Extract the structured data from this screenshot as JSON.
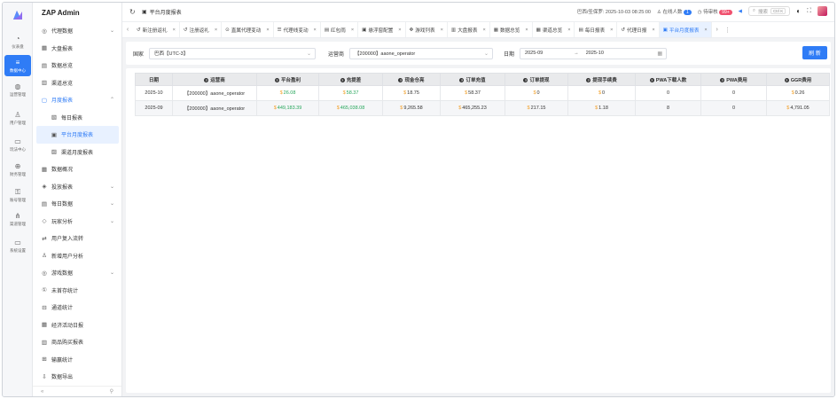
{
  "app": {
    "name": "ZAP Admin"
  },
  "rail": [
    {
      "label": "仪表盘",
      "icon": "dashboard-icon"
    },
    {
      "label": "数据中心",
      "icon": "database-icon",
      "active": true
    },
    {
      "label": "运营管理",
      "icon": "operations-icon"
    },
    {
      "label": "用户管理",
      "icon": "user-icon"
    },
    {
      "label": "玩法中心",
      "icon": "game-icon"
    },
    {
      "label": "财务管理",
      "icon": "globe-icon"
    },
    {
      "label": "账号管理",
      "icon": "key-icon"
    },
    {
      "label": "渠道管理",
      "icon": "channel-icon"
    },
    {
      "label": "系统设置",
      "icon": "monitor-icon"
    }
  ],
  "menu": [
    {
      "label": "代理数据",
      "icon": "◎",
      "chevron": "⌄"
    },
    {
      "label": "大盘报表",
      "icon": "▦"
    },
    {
      "label": "数据总览",
      "icon": "▤"
    },
    {
      "label": "渠道总览",
      "icon": "▥"
    },
    {
      "label": "月度报表",
      "icon": "▢",
      "chevron": "⌃",
      "open": true
    },
    {
      "label": "每日报表",
      "icon": "▧",
      "sub": true
    },
    {
      "label": "平台月度报表",
      "icon": "▣",
      "sub": true,
      "active": true
    },
    {
      "label": "渠道月度报表",
      "icon": "▨",
      "sub": true
    },
    {
      "label": "数据概况",
      "icon": "▦"
    },
    {
      "label": "投放报表",
      "icon": "◈",
      "chevron": "⌄"
    },
    {
      "label": "每日数据",
      "icon": "▤",
      "chevron": "⌄"
    },
    {
      "label": "玩家分析",
      "icon": "◇",
      "chevron": "⌄"
    },
    {
      "label": "用户复入流转",
      "icon": "⇄"
    },
    {
      "label": "新增用户分析",
      "icon": "♙"
    },
    {
      "label": "游戏数据",
      "icon": "◎",
      "chevron": "⌄"
    },
    {
      "label": "未首存统计",
      "icon": "①"
    },
    {
      "label": "通道统计",
      "icon": "⊟"
    },
    {
      "label": "经济活动日报",
      "icon": "▦"
    },
    {
      "label": "商品购买报表",
      "icon": "▥"
    },
    {
      "label": "输赢统计",
      "icon": "⊞"
    },
    {
      "label": "数据导出",
      "icon": "⇩"
    }
  ],
  "header": {
    "page_title": "平台月度报表",
    "location_time": "巴西/圣保罗: 2025-10-03 08:25:00",
    "online_label": "在线人数",
    "online_count": "1",
    "pending_label": "待审核",
    "pending_count": "99+",
    "search_placeholder": "搜索",
    "search_shortcut": "Ctrl K"
  },
  "tabs": [
    {
      "label": "新注册返礼",
      "icon": "↺"
    },
    {
      "label": "注册返礼",
      "icon": "↺"
    },
    {
      "label": "直属代理变动",
      "icon": "⊙"
    },
    {
      "label": "代理线变动",
      "icon": "☰"
    },
    {
      "label": "红包雨",
      "icon": "▤"
    },
    {
      "label": "悬浮窗配置",
      "icon": "▣"
    },
    {
      "label": "游戏列表",
      "icon": "✥"
    },
    {
      "label": "大盘报表",
      "icon": "▥"
    },
    {
      "label": "数据总览",
      "icon": "▦"
    },
    {
      "label": "渠道总览",
      "icon": "▦"
    },
    {
      "label": "每日报表",
      "icon": "▤"
    },
    {
      "label": "代理日报",
      "icon": "↺"
    },
    {
      "label": "平台月度报表",
      "icon": "▣",
      "active": true
    }
  ],
  "filters": {
    "country_label": "国家",
    "country_value": "巴西【UTC-3】",
    "operator_label": "运营商",
    "operator_value": "【200000】aaone_operator",
    "date_label": "日期",
    "date_start": "2025-09",
    "date_end": "2025-10",
    "refresh_label": "刷 新"
  },
  "table": {
    "columns": [
      "日期",
      "运营商",
      "平台盈利",
      "充提差",
      "现金仓亮",
      "订单充值",
      "订单提现",
      "提现手续费",
      "PWA下载人数",
      "PWA费用",
      "GGR费用"
    ],
    "rows": [
      {
        "date": "2025-10",
        "operator": "【200000】aaone_operator",
        "profit": "26.08",
        "deposit_diff": "58.37",
        "cash": "18.75",
        "order_deposit": "58.37",
        "order_withdraw": "0",
        "withdraw_fee": "0",
        "pwa_downloads": "0",
        "pwa_cost": "0",
        "ggr_cost": "0.26"
      },
      {
        "date": "2025-09",
        "operator": "【200000】aaone_operator",
        "profit": "449,183.39",
        "deposit_diff": "465,038.08",
        "cash": "9,265.58",
        "order_deposit": "465,255.23",
        "order_withdraw": "217.15",
        "withdraw_fee": "1.18",
        "pwa_downloads": "8",
        "pwa_cost": "0",
        "ggr_cost": "4,791.05"
      }
    ]
  }
}
